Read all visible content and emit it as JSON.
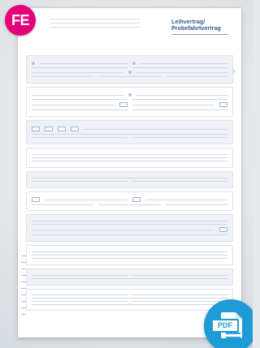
{
  "document": {
    "title_line_1": "Leihvertrag/",
    "title_line_2": "Probefahrtvertrag"
  },
  "badges": {
    "left": "FE",
    "right": "PDF",
    "colors": {
      "fe_background": "#e4007a",
      "pdf_background": "#1e9ad6",
      "title_text": "#2f5a8a"
    },
    "icons": [
      "fe-badge-icon",
      "pdf-file-icon"
    ]
  }
}
